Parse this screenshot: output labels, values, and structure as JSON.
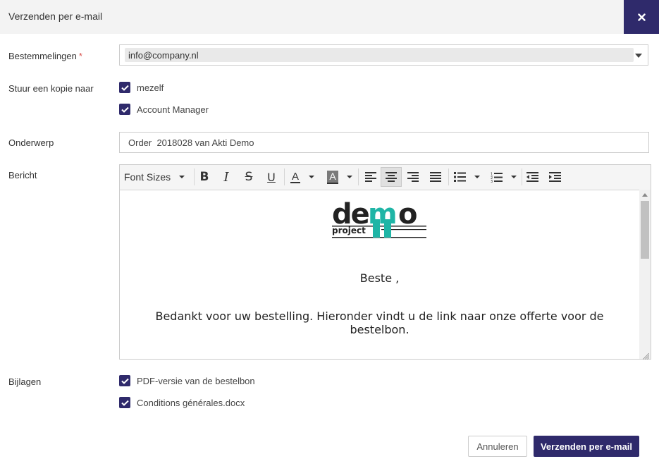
{
  "dialog": {
    "title": "Verzenden per e-mail"
  },
  "recipients": {
    "label": "Bestemmelingen",
    "required_mark": "*",
    "value": "info@company.nl"
  },
  "copy": {
    "label": "Stuur een kopie naar",
    "options": [
      {
        "label": "mezelf",
        "checked": true
      },
      {
        "label": "Account Manager",
        "checked": true
      }
    ]
  },
  "subject": {
    "label": "Onderwerp",
    "value": "Order  2018028 van Akti Demo"
  },
  "message": {
    "label": "Bericht",
    "toolbar": {
      "font_sizes": "Font Sizes",
      "icons": [
        "bold-icon",
        "italic-icon",
        "strikethrough-icon",
        "underline-icon",
        "text-color-icon",
        "background-color-icon",
        "align-left-icon",
        "align-center-icon",
        "align-right-icon",
        "align-justify-icon",
        "bullet-list-icon",
        "numbered-list-icon",
        "outdent-icon",
        "indent-icon"
      ],
      "active": "align-center"
    },
    "logo_text": {
      "top": "demo",
      "bottom": "project"
    },
    "greeting": "Beste ,",
    "body": "Bedankt voor uw bestelling. Hieronder vindt u de link naar onze offerte voor de bestelbon."
  },
  "attachments": {
    "label": "Bijlagen",
    "items": [
      {
        "label": "PDF-versie van de bestelbon",
        "checked": true
      },
      {
        "label": "Conditions générales.docx",
        "checked": true
      }
    ]
  },
  "actions": {
    "cancel": "Annuleren",
    "send": "Verzenden per e-mail"
  },
  "colors": {
    "accent": "#2f2a6b",
    "logo_teal": "#1fb5a6"
  }
}
